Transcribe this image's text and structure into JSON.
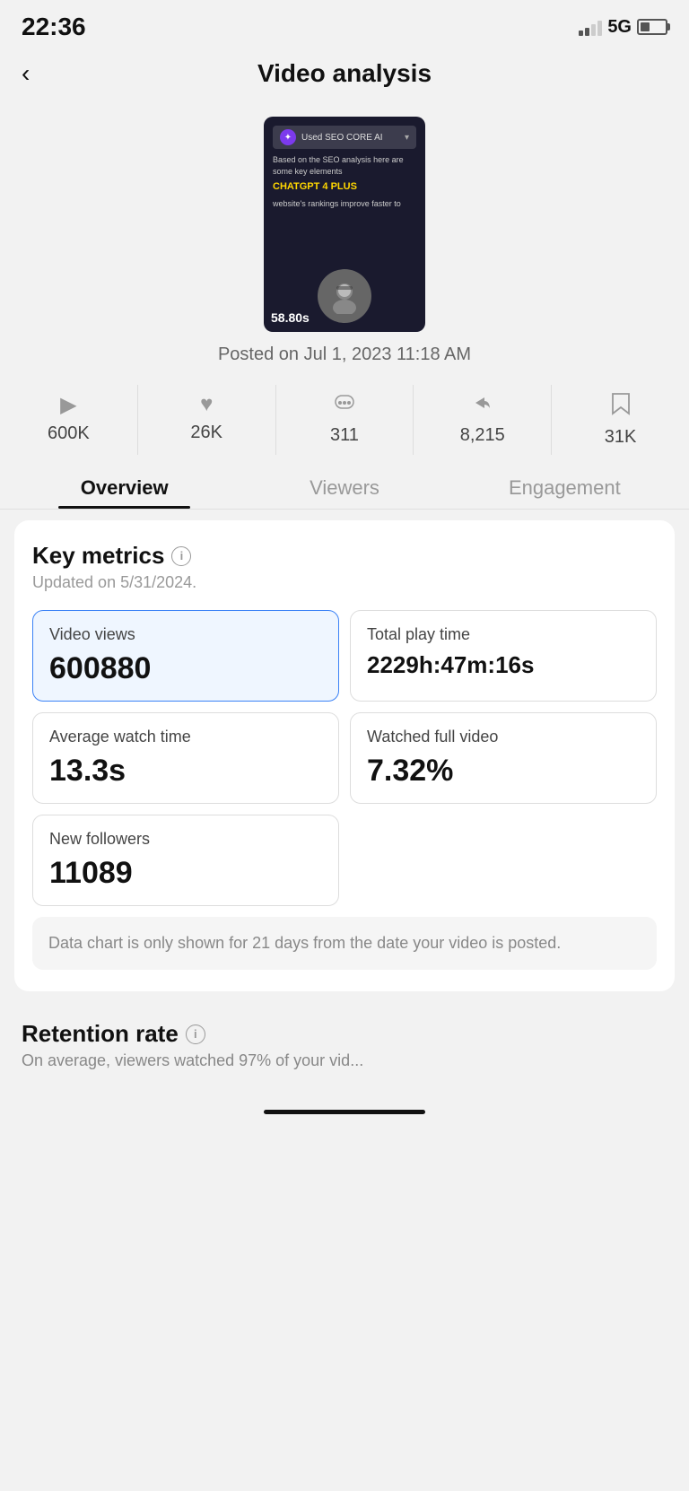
{
  "statusBar": {
    "time": "22:36",
    "network": "5G"
  },
  "header": {
    "back_label": "<",
    "title": "Video analysis"
  },
  "video": {
    "duration": "58.80s",
    "post_date": "Posted on Jul 1, 2023 11:18 AM",
    "content_line1": "Used SEO CORE AI",
    "content_line2": "Based on the SEO analysis here are some key elements",
    "highlight": "CHATGPT 4 PLUS",
    "content_line3": "website's rankings improve faster to"
  },
  "stats": [
    {
      "icon": "▶",
      "value": "600K",
      "label": "plays"
    },
    {
      "icon": "♥",
      "value": "26K",
      "label": "likes"
    },
    {
      "icon": "💬",
      "value": "311",
      "label": "comments"
    },
    {
      "icon": "➤",
      "value": "8,215",
      "label": "shares"
    },
    {
      "icon": "🔖",
      "value": "31K",
      "label": "bookmarks"
    }
  ],
  "tabs": [
    {
      "label": "Overview",
      "active": true
    },
    {
      "label": "Viewers",
      "active": false
    },
    {
      "label": "Engagement",
      "active": false
    }
  ],
  "keyMetrics": {
    "title": "Key metrics",
    "subtitle": "Updated on 5/31/2024.",
    "metrics": [
      {
        "label": "Video views",
        "value": "600880",
        "highlighted": true,
        "fullWidth": false
      },
      {
        "label": "Total play time",
        "value": "2229h:47m:16s",
        "highlighted": false,
        "fullWidth": false
      },
      {
        "label": "Average watch time",
        "value": "13.3s",
        "highlighted": false,
        "fullWidth": false
      },
      {
        "label": "Watched full video",
        "value": "7.32%",
        "highlighted": false,
        "fullWidth": false
      },
      {
        "label": "New followers",
        "value": "11089",
        "highlighted": false,
        "fullWidth": false
      }
    ],
    "chartNotice": "Data chart is only shown for 21 days from the date your video is posted."
  },
  "retentionRate": {
    "title": "Retention rate",
    "info": "i",
    "subtitle": "On average, viewers watched 97% of your vid..."
  }
}
